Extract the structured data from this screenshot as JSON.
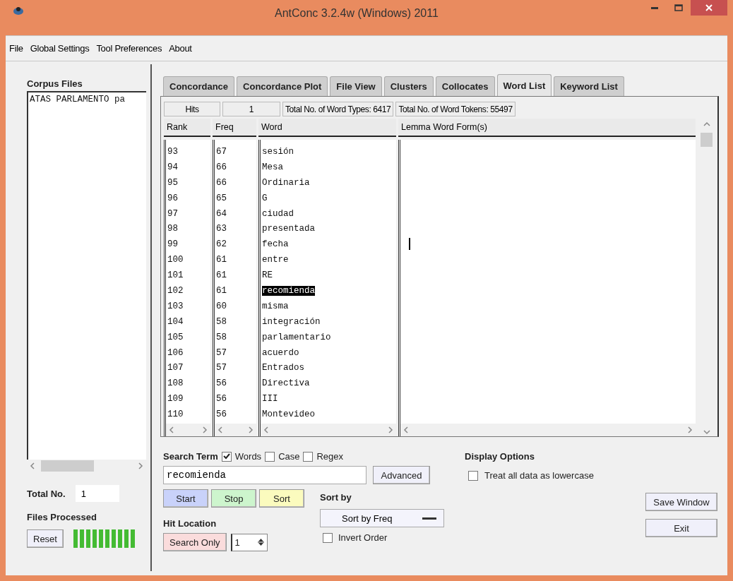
{
  "window": {
    "title": "AntConc 3.2.4w (Windows) 2011"
  },
  "menu": [
    "File",
    "Global Settings",
    "Tool Preferences",
    "About"
  ],
  "corpus": {
    "label": "Corpus Files",
    "files": [
      {
        "name": "ATAS PARLAMENTO pa",
        "selected": false
      }
    ]
  },
  "total": {
    "label": "Total No.",
    "value": "1"
  },
  "processed": {
    "label": "Files Processed",
    "level": 1
  },
  "reset_button": "Reset",
  "tabs": [
    {
      "label": "Concordance",
      "selected": false
    },
    {
      "label": "Concordance Plot",
      "selected": false
    },
    {
      "label": "File View",
      "selected": false
    },
    {
      "label": "Clusters",
      "selected": false
    },
    {
      "label": "Collocates",
      "selected": false
    },
    {
      "label": "Word List",
      "selected": true
    },
    {
      "label": "Keyword List",
      "selected": false
    }
  ],
  "stats": {
    "hits_label": "Hits",
    "hits_value": "1",
    "types": "Total No. of Word Types: 6417",
    "tokens": "Total No. of Word Tokens: 55497"
  },
  "table": {
    "columns": [
      "Rank",
      "Freq",
      "Word",
      "Lemma Word Form(s)"
    ],
    "rows": [
      {
        "rank": "93",
        "freq": "67",
        "word": "sesión",
        "selected": false
      },
      {
        "rank": "94",
        "freq": "66",
        "word": "Mesa",
        "selected": false
      },
      {
        "rank": "95",
        "freq": "66",
        "word": "Ordinaria",
        "selected": false
      },
      {
        "rank": "96",
        "freq": "65",
        "word": "G",
        "selected": false
      },
      {
        "rank": "97",
        "freq": "64",
        "word": "ciudad",
        "selected": false
      },
      {
        "rank": "98",
        "freq": "63",
        "word": "presentada",
        "selected": false
      },
      {
        "rank": "99",
        "freq": "62",
        "word": "fecha",
        "selected": false
      },
      {
        "rank": "100",
        "freq": "61",
        "word": "entre",
        "selected": false
      },
      {
        "rank": "101",
        "freq": "61",
        "word": "RE",
        "selected": false
      },
      {
        "rank": "102",
        "freq": "61",
        "word": "recomienda",
        "selected": true
      },
      {
        "rank": "103",
        "freq": "60",
        "word": "misma",
        "selected": false
      },
      {
        "rank": "104",
        "freq": "58",
        "word": "integración",
        "selected": false
      },
      {
        "rank": "105",
        "freq": "58",
        "word": "parlamentario",
        "selected": false
      },
      {
        "rank": "106",
        "freq": "57",
        "word": "acuerdo",
        "selected": false
      },
      {
        "rank": "107",
        "freq": "57",
        "word": "Entrados",
        "selected": false
      },
      {
        "rank": "108",
        "freq": "56",
        "word": "Directiva",
        "selected": false
      },
      {
        "rank": "109",
        "freq": "56",
        "word": "III",
        "selected": false
      },
      {
        "rank": "110",
        "freq": "56",
        "word": "Montevideo",
        "selected": false
      }
    ]
  },
  "search": {
    "label": "Search Term",
    "options": [
      {
        "label": "Words",
        "checked": true
      },
      {
        "label": "Case",
        "checked": false
      },
      {
        "label": "Regex",
        "checked": false
      }
    ],
    "value": "recomienda",
    "advanced_button": "Advanced"
  },
  "actions": [
    {
      "label": "Start",
      "kind": "start"
    },
    {
      "label": "Stop",
      "kind": "stop"
    },
    {
      "label": "Sort",
      "kind": "sort"
    }
  ],
  "hit_location": {
    "label": "Hit Location",
    "button": "Search Only",
    "value": "1"
  },
  "sort_by": {
    "label": "Sort by",
    "value": "Sort by Freq",
    "invert": {
      "label": "Invert Order",
      "checked": false
    }
  },
  "display_options": {
    "label": "Display Options",
    "option": {
      "label": "Treat all data as lowercase",
      "checked": false
    }
  },
  "save_button": "Save Window",
  "exit_button": "Exit"
}
